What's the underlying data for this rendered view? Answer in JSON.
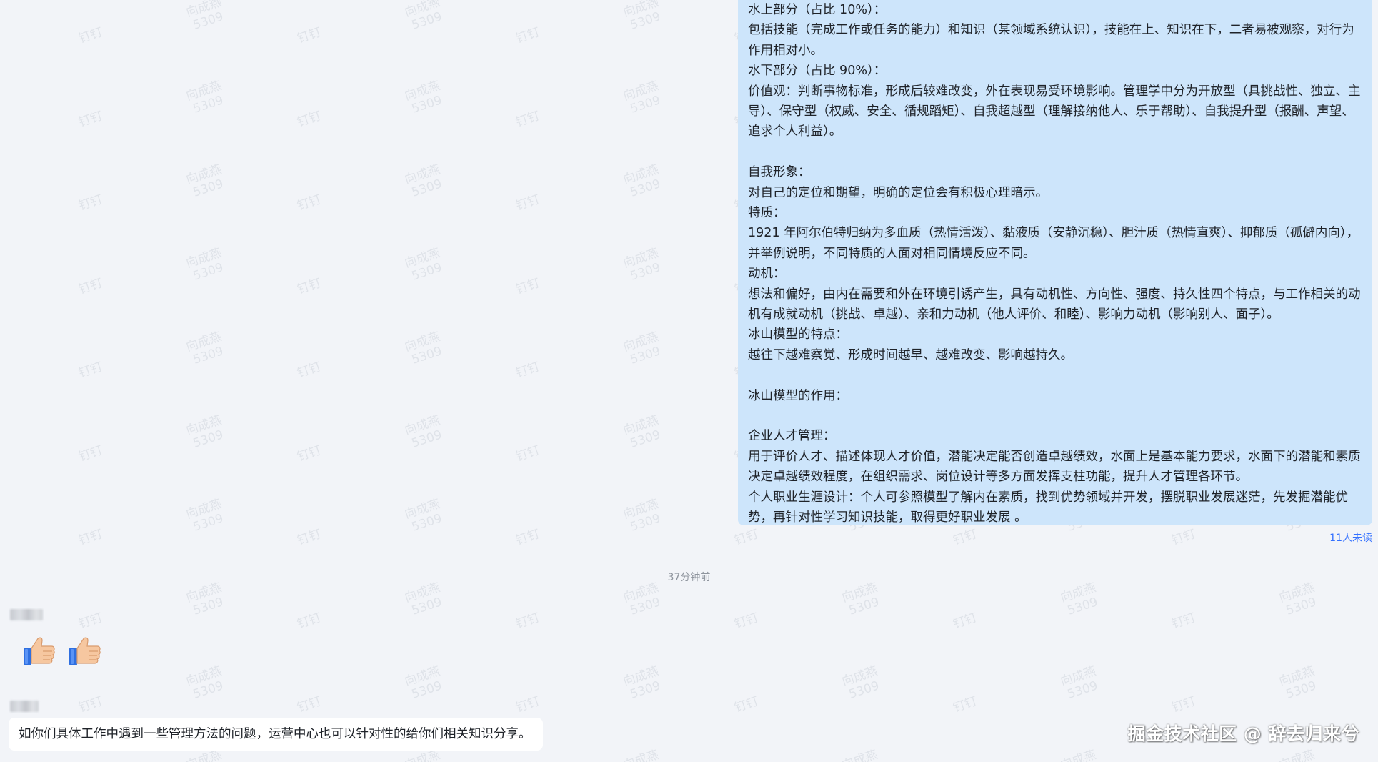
{
  "sent_message": {
    "lines": [
      "水上部分（占比 10%）：",
      "包括技能（完成工作或任务的能力）和知识（某领域系统认识），技能在上、知识在下，二者易被观察，对行为作用相对小。",
      "水下部分（占比 90%）：",
      "价值观：判断事物标准，形成后较难改变，外在表现易受环境影响。管理学中分为开放型（具挑战性、独立、主导）、保守型（权威、安全、循规蹈矩）、自我超越型（理解接纳他人、乐于帮助）、自我提升型（报酬、声望、追求个人利益）。",
      "",
      "自我形象：",
      "对自己的定位和期望，明确的定位会有积极心理暗示。",
      "特质：",
      "1921 年阿尔伯特归纳为多血质（热情活泼）、黏液质（安静沉稳）、胆汁质（热情直爽）、抑郁质（孤僻内向），并举例说明，不同特质的人面对相同情境反应不同。",
      "动机：",
      "想法和偏好，由内在需要和外在环境引诱产生，具有动机性、方向性、强度、持久性四个特点，与工作相关的动机有成就动机（挑战、卓越）、亲和力动机（他人评价、和睦）、影响力动机（影响别人、面子）。",
      "冰山模型的特点：",
      "越往下越难察觉、形成时间越早、越难改变、影响越持久。",
      "",
      "冰山模型的作用：",
      "",
      "企业人才管理：",
      "用于评价人才、描述体现人才价值，潜能决定能否创造卓越绩效，水面上是基本能力要求，水面下的潜能和素质决定卓越绩效程度，在组织需求、岗位设计等多方面发挥支柱功能，提升人才管理各环节。",
      "个人职业生涯设计：个人可参照模型了解内在素质，找到优势领域并开发，摆脱职业发展迷茫，先发掘潜能优势，再针对性学习知识技能，取得更好职业发展 。"
    ],
    "read_status": "11人未读"
  },
  "timestamp": "37分钟前",
  "emoji_message": {
    "emojis": [
      "thumbs-up",
      "thumbs-up"
    ]
  },
  "received_message": {
    "text": "如你们具体工作中遇到一些管理方法的问题，运营中心也可以针对性的给你们相关知识分享。"
  },
  "background_watermark": {
    "line1": "向成燕",
    "line2": "5309",
    "line3": "钉钉"
  },
  "source_watermark": "掘金技术社区 @ 辞去归来兮",
  "colors": {
    "chat_background": "#f2f4f8",
    "sent_bubble": "#cde5fb",
    "received_bubble": "#ffffff",
    "read_status": "#3370ff",
    "timestamp": "#8f959e"
  }
}
